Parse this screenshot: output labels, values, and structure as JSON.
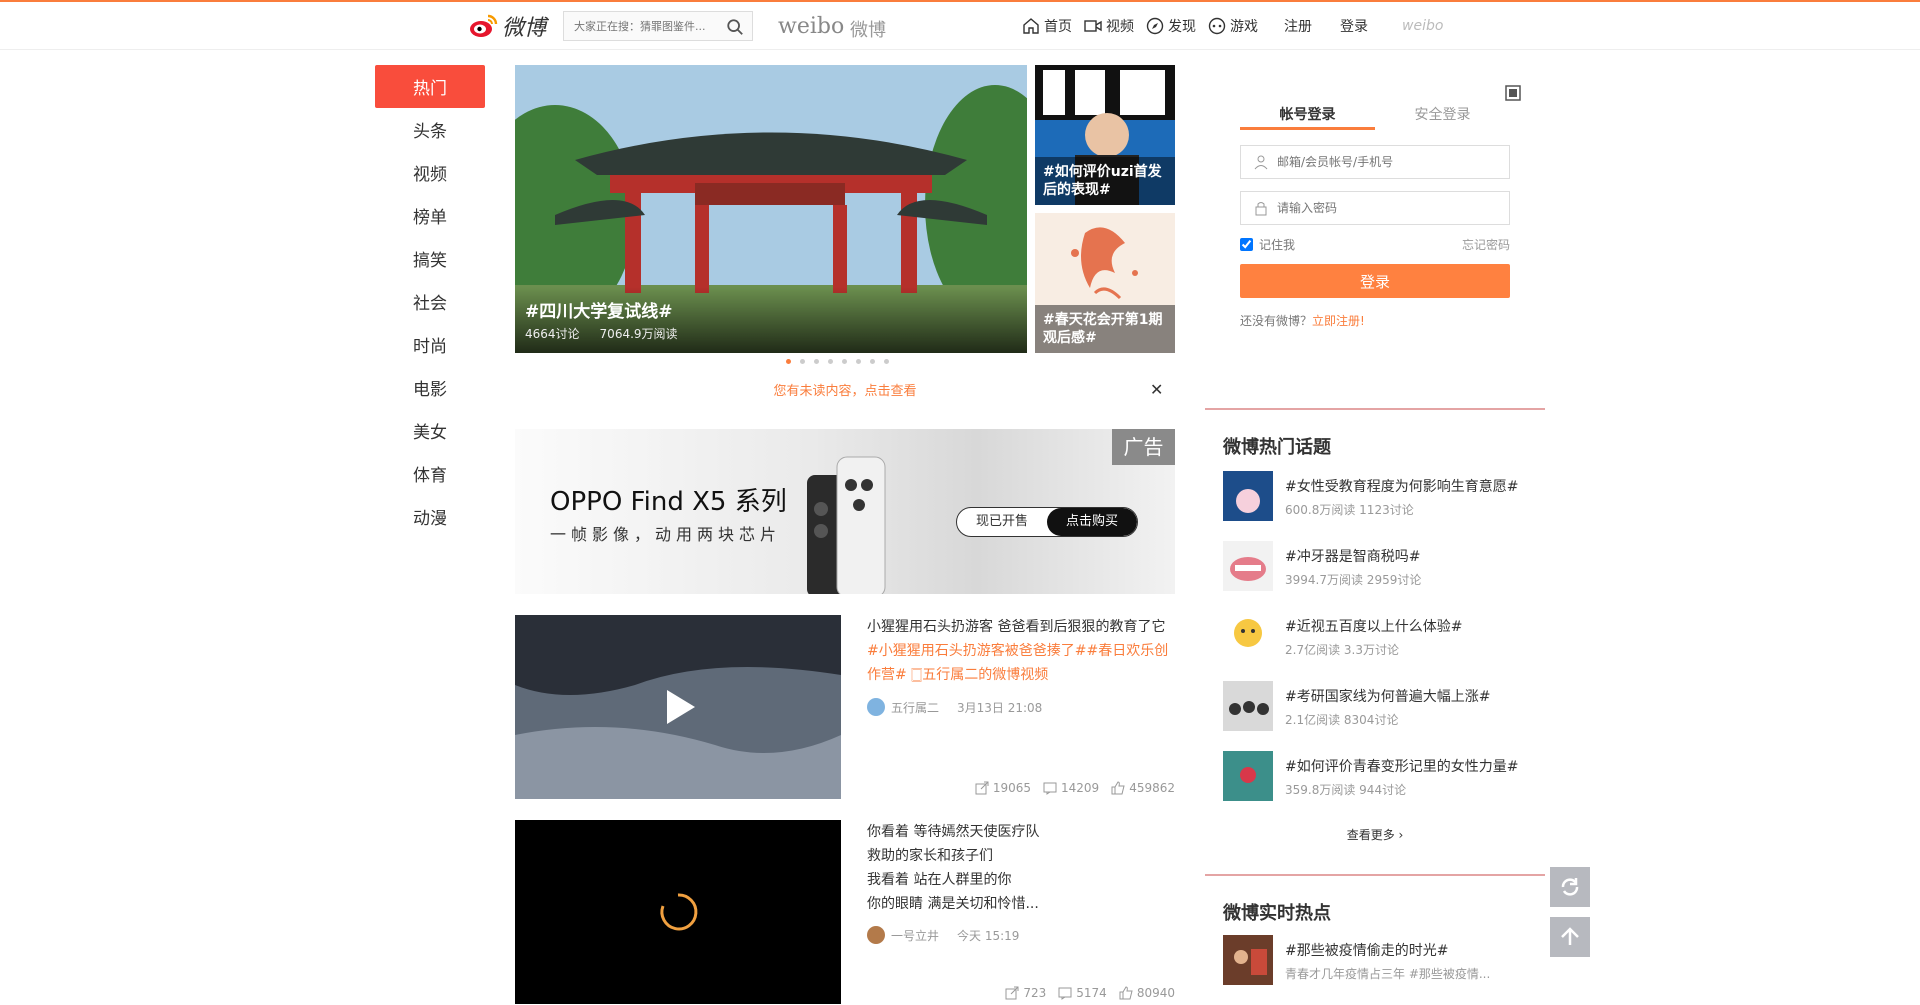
{
  "header": {
    "logo": "微博",
    "search_placeholder": "大家正在搜：猜罪图鉴件...",
    "brand_text": "weibo",
    "brand_cn": "微博",
    "nav": [
      "首页",
      "视频",
      "发现",
      "游戏",
      "注册",
      "登录"
    ],
    "logo_small": "weibo"
  },
  "left_nav": [
    "热门",
    "头条",
    "视频",
    "榜单",
    "搞笑",
    "社会",
    "时尚",
    "电影",
    "美女",
    "体育",
    "动漫"
  ],
  "carousel": {
    "main_title": "#四川大学复试线#",
    "main_discussions": "4664讨论",
    "main_reads": "7064.9万阅读",
    "side1": "#如何评价uzi首发后的表现#",
    "side2": "#春天花会开第1期观后感#"
  },
  "unread": "您有未读内容，点击查看",
  "ad": {
    "tag": "广告",
    "title": "OPPO Find X5 系列",
    "subtitle": "一帧影像，动用两块芯片",
    "btn1": "现已开售",
    "btn2": "点击购买"
  },
  "feed": [
    {
      "text": "小猩猩用石头扔游客 爸爸看到后狠狠的教育了它",
      "tags": "#小猩猩用石头扔游客被爸爸揍了##春日欢乐创作营# 🀆五行属二的微博视频",
      "author": "五行属二",
      "time": "3月13日 21:08",
      "shares": "19065",
      "comments": "14209",
      "likes": "459862"
    },
    {
      "text_lines": [
        "你看着 等待嫣然天使医疗队",
        "救助的家长和孩子们",
        "我看着 站在人群里的你",
        "你的眼睛 满是关切和怜惜..."
      ],
      "author": "一号立井",
      "time": "今天 15:19",
      "shares": "723",
      "comments": "5174",
      "likes": "80940"
    }
  ],
  "login": {
    "tab_account": "帐号登录",
    "tab_secure": "安全登录",
    "user_placeholder": "邮箱/会员帐号/手机号",
    "pass_placeholder": "请输入密码",
    "remember": "记住我",
    "forgot": "忘记密码",
    "button": "登录",
    "reg_text": "还没有微博？",
    "reg_link": "立即注册!"
  },
  "hot_topics": {
    "title": "微博热门话题",
    "items": [
      {
        "title": "#女性受教育程度为何影响生育意愿#",
        "meta": "600.8万阅读 1123讨论"
      },
      {
        "title": "#冲牙器是智商税吗#",
        "meta": "3994.7万阅读 2959讨论"
      },
      {
        "title": "#近视五百度以上什么体验#",
        "meta": "2.7亿阅读 3.3万讨论"
      },
      {
        "title": "#考研国家线为何普遍大幅上涨#",
        "meta": "2.1亿阅读 8304讨论"
      },
      {
        "title": "#如何评价青春变形记里的女性力量#",
        "meta": "359.8万阅读 944讨论"
      }
    ],
    "more": "查看更多 ›"
  },
  "realtime": {
    "title": "微博实时热点",
    "item_title": "#那些被疫情偷走的时光#",
    "item_meta": "青春才几年疫情占三年 #那些被疫情..."
  },
  "colors": {
    "accent": "#fa7d3c",
    "active_nav": "#f94d3c",
    "login_button": "#ff8140"
  }
}
